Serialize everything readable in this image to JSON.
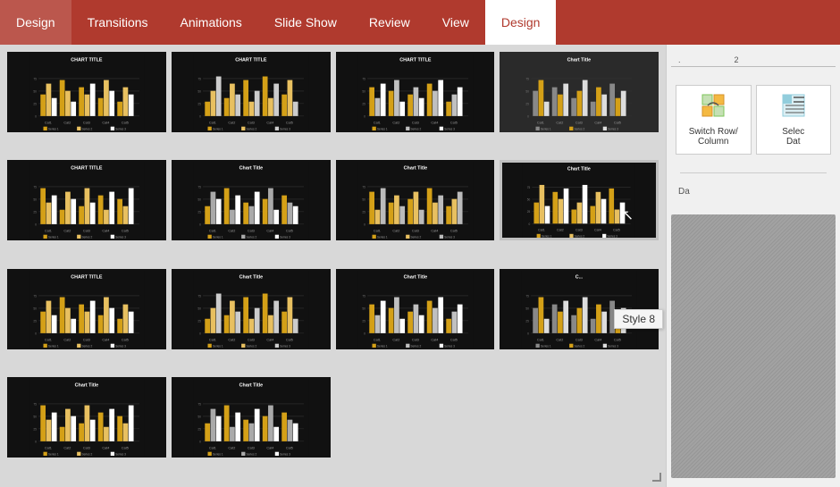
{
  "ribbon": {
    "tabs": [
      {
        "label": "Design",
        "active": false
      },
      {
        "label": "Transitions",
        "active": false
      },
      {
        "label": "Animations",
        "active": false
      },
      {
        "label": "Slide Show",
        "active": false
      },
      {
        "label": "Review",
        "active": false
      },
      {
        "label": "View",
        "active": false
      },
      {
        "label": "Design",
        "active": true
      }
    ]
  },
  "panel": {
    "switch_row_col_label": "Switch Row/",
    "column_label": "Column",
    "select_data_label": "Selec",
    "data_label": "Dat",
    "da_label": "Da"
  },
  "tooltip": {
    "text": "Style 8"
  },
  "ruler": {
    "marker": "2"
  },
  "chart_styles": [
    {
      "id": 1,
      "title": "CHART TITLE",
      "style": "dark"
    },
    {
      "id": 2,
      "title": "CHART TITLE",
      "style": "dark"
    },
    {
      "id": 3,
      "title": "CHART TITLE",
      "style": "dark"
    },
    {
      "id": 4,
      "title": "Chart Title",
      "style": "light"
    },
    {
      "id": 5,
      "title": "CHART TITLE",
      "style": "dark"
    },
    {
      "id": 6,
      "title": "Chart Title",
      "style": "dark"
    },
    {
      "id": 7,
      "title": "Chart Title",
      "style": "dark"
    },
    {
      "id": 8,
      "title": "Chart Title",
      "style": "dark_selected"
    },
    {
      "id": 9,
      "title": "CHART TITLE",
      "style": "dark"
    },
    {
      "id": 10,
      "title": "Chart Title",
      "style": "dark"
    },
    {
      "id": 11,
      "title": "Chart Title",
      "style": "dark"
    },
    {
      "id": 12,
      "title": "C...",
      "style": "dark"
    },
    {
      "id": 13,
      "title": "Chart Title",
      "style": "dark"
    },
    {
      "id": 14,
      "title": "Chart Title",
      "style": "dark"
    }
  ],
  "bar_colors": {
    "gold": "#d4a017",
    "light_gold": "#e8c060",
    "white": "#ffffff",
    "gray": "#888888",
    "dark_gray": "#444444"
  }
}
